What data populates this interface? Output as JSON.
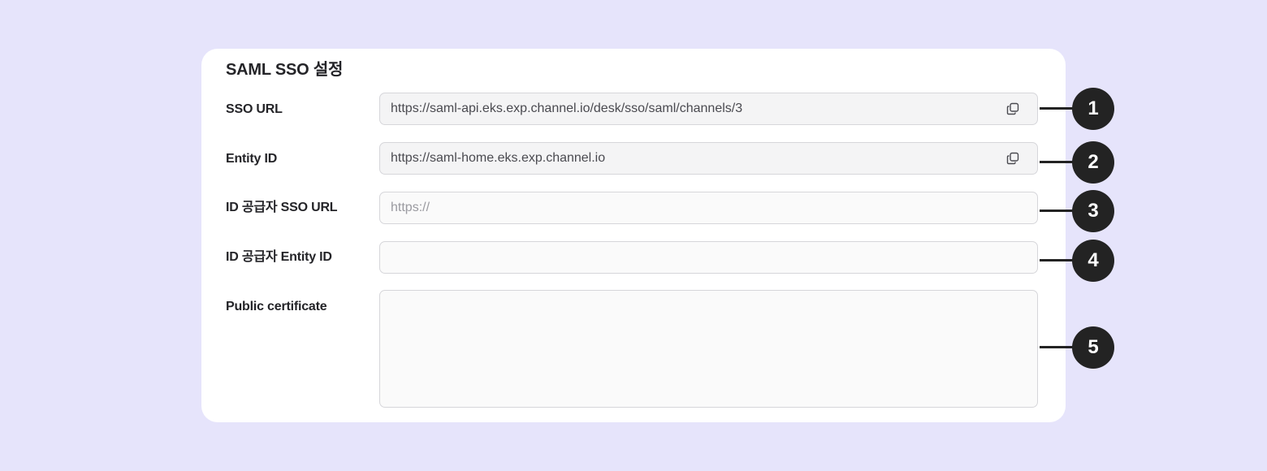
{
  "panel": {
    "title": "SAML SSO 설정"
  },
  "fields": [
    {
      "label": "SSO URL",
      "value": "https://saml-api.eks.exp.channel.io/desk/sso/saml/channels/3",
      "placeholder": "",
      "readonly": true,
      "copy_icon": "copy-icon"
    },
    {
      "label": "Entity ID",
      "value": "https://saml-home.eks.exp.channel.io",
      "placeholder": "",
      "readonly": true,
      "copy_icon": "copy-icon"
    },
    {
      "label": "ID 공급자 SSO URL",
      "value": "",
      "placeholder": "https://",
      "readonly": false
    },
    {
      "label": "ID 공급자 Entity ID",
      "value": "",
      "placeholder": "",
      "readonly": false
    },
    {
      "label": "Public certificate",
      "value": "",
      "placeholder": "",
      "readonly": false,
      "multiline": true
    }
  ],
  "callouts": [
    "1",
    "2",
    "3",
    "4",
    "5"
  ],
  "colors": {
    "background": "#e6e4fb",
    "card": "#ffffff",
    "badge": "#232323",
    "field_border": "#d6d6da"
  }
}
